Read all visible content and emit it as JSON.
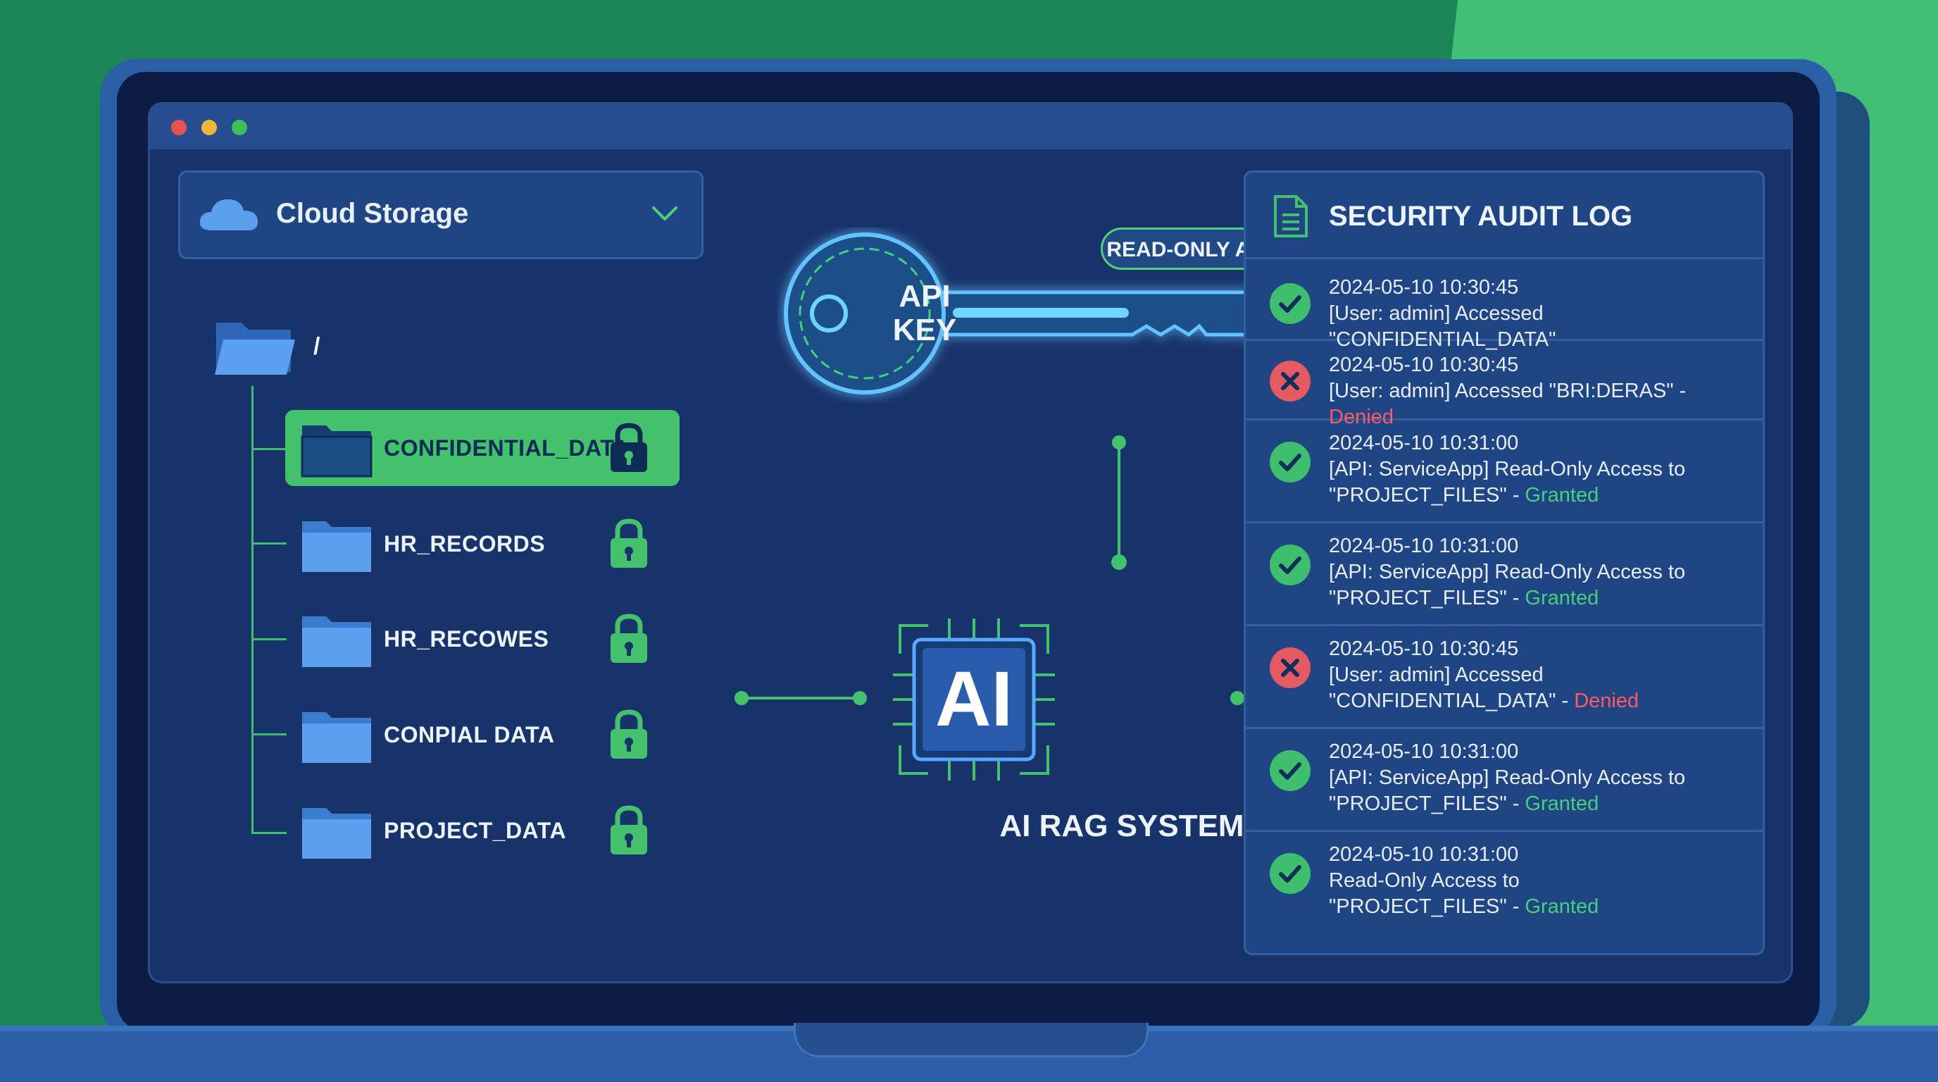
{
  "colors": {
    "accent_green": "#43c16d",
    "panel_blue": "#1f4585",
    "screen_bg": "#18336a",
    "granted": "#46d07a",
    "denied": "#ff5a62"
  },
  "window": {
    "controls": [
      {
        "name": "close",
        "color": "#e8514f"
      },
      {
        "name": "minimize",
        "color": "#f3b43c"
      },
      {
        "name": "maximize",
        "color": "#3fbf55"
      }
    ]
  },
  "storage": {
    "title": "Cloud Storage",
    "icon": "cloud-icon",
    "dropdown_icon": "chevron-down-icon",
    "root_path": "/",
    "folders": [
      {
        "label": "CONFIDENTIAL_DATA",
        "highlighted": true,
        "icon": "lock-icon"
      },
      {
        "label": "HR_RECORDS",
        "highlighted": false,
        "icon": "lock-icon"
      },
      {
        "label": "HR_RECOWES",
        "highlighted": false,
        "icon": "lock-icon"
      },
      {
        "label": "CONPIAL DATA",
        "highlighted": false,
        "icon": "lock-icon"
      },
      {
        "label": "PROJECT_DATA",
        "highlighted": false,
        "icon": "lock-icon"
      }
    ]
  },
  "api_key": {
    "line1": "API",
    "line2": "KEY",
    "access_badge": "READ-ONLY ACCESS"
  },
  "ai_system": {
    "chip_label": "AI",
    "title": "AI RAG SYSTEM"
  },
  "audit_log": {
    "title": "SECURITY AUDIT LOG",
    "icon": "document-icon",
    "entries": [
      {
        "status": "ok",
        "timestamp": "2024-05-10 10:30:45",
        "message": "[User: admin] Accessed \"CONFIDENTIAL_DATA\"",
        "result": ""
      },
      {
        "status": "bad",
        "timestamp": "2024-05-10 10:30:45",
        "message": "[User: admin] Accessed \"BRI:DERAS\" - ",
        "result": "Denied"
      },
      {
        "status": "ok",
        "timestamp": "2024-05-10 10:31:00",
        "message": "[API: ServiceApp] Read-Only Access to \"PROJECT_FILES\" - ",
        "result": "Granted"
      },
      {
        "status": "ok",
        "timestamp": "2024-05-10 10:31:00",
        "message": "[API: ServiceApp] Read-Only Access to \"PROJECT_FILES\" - ",
        "result": "Granted"
      },
      {
        "status": "bad",
        "timestamp": "2024-05-10 10:30:45",
        "message": "[User: admin] Accessed \"CONFIDENTIAL_DATA\" - ",
        "result": "Denied"
      },
      {
        "status": "ok",
        "timestamp": "2024-05-10 10:31:00",
        "message": "[API: ServiceApp] Read-Only Access to \"PROJECT_FILES\" - ",
        "result": "Granted"
      },
      {
        "status": "ok",
        "timestamp": "2024-05-10 10:31:00",
        "message": "Read-Only Access to \"PROJECT_FILES\" - ",
        "result": "Granted"
      }
    ]
  }
}
